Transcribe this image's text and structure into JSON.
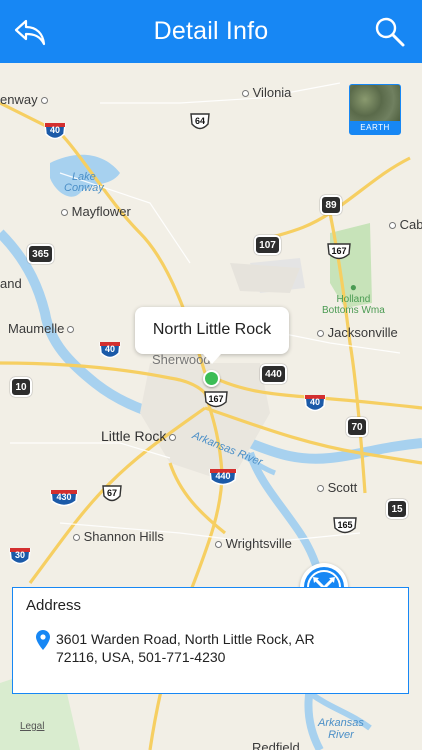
{
  "header": {
    "title": "Detail Info",
    "back_icon": "back-arrow-icon",
    "search_icon": "search-icon",
    "color": "#1787f4"
  },
  "map": {
    "earth_label": "EARTH",
    "callout": "North Little Rock",
    "places": {
      "vilonia": "Vilonia",
      "conway": "enway",
      "lake_conway_1": "Lake",
      "lake_conway_2": "Conway",
      "mayflower": "Mayflower",
      "cabot": "Cabo",
      "and": "and",
      "holland_1": "Holland",
      "holland_2": "Bottoms Wma",
      "jacksonville": "Jacksonville",
      "maumelle": "Maumelle",
      "sherwood": "Sherwood",
      "little_rock": "Little Rock",
      "arkansas_river": "Arkansas River",
      "scott": "Scott",
      "shannon_hills": "Shannon Hills",
      "wrightsville": "Wrightsville",
      "arkansas_river_2a": "Arkansas",
      "arkansas_river_2b": "River",
      "redfield": "Redfield"
    },
    "shields": {
      "i40_nw": "40",
      "us64": "64",
      "hw89": "89",
      "hw365": "365",
      "hw107": "107",
      "us167_ne": "167",
      "i40_w": "40",
      "hw10": "10",
      "hw440_n": "440",
      "us167": "167",
      "i40_e": "40",
      "hw70": "70",
      "i440": "440",
      "i430": "430",
      "us67": "67",
      "hw15": "15",
      "us165": "165",
      "i30": "30"
    },
    "legal": "Legal"
  },
  "address": {
    "heading": "Address",
    "text": "3601 Warden Road, North Little Rock, AR 72116, USA, 501-771-4230",
    "location_icon": "location-pin-icon",
    "directions_icon": "directions-icon"
  }
}
